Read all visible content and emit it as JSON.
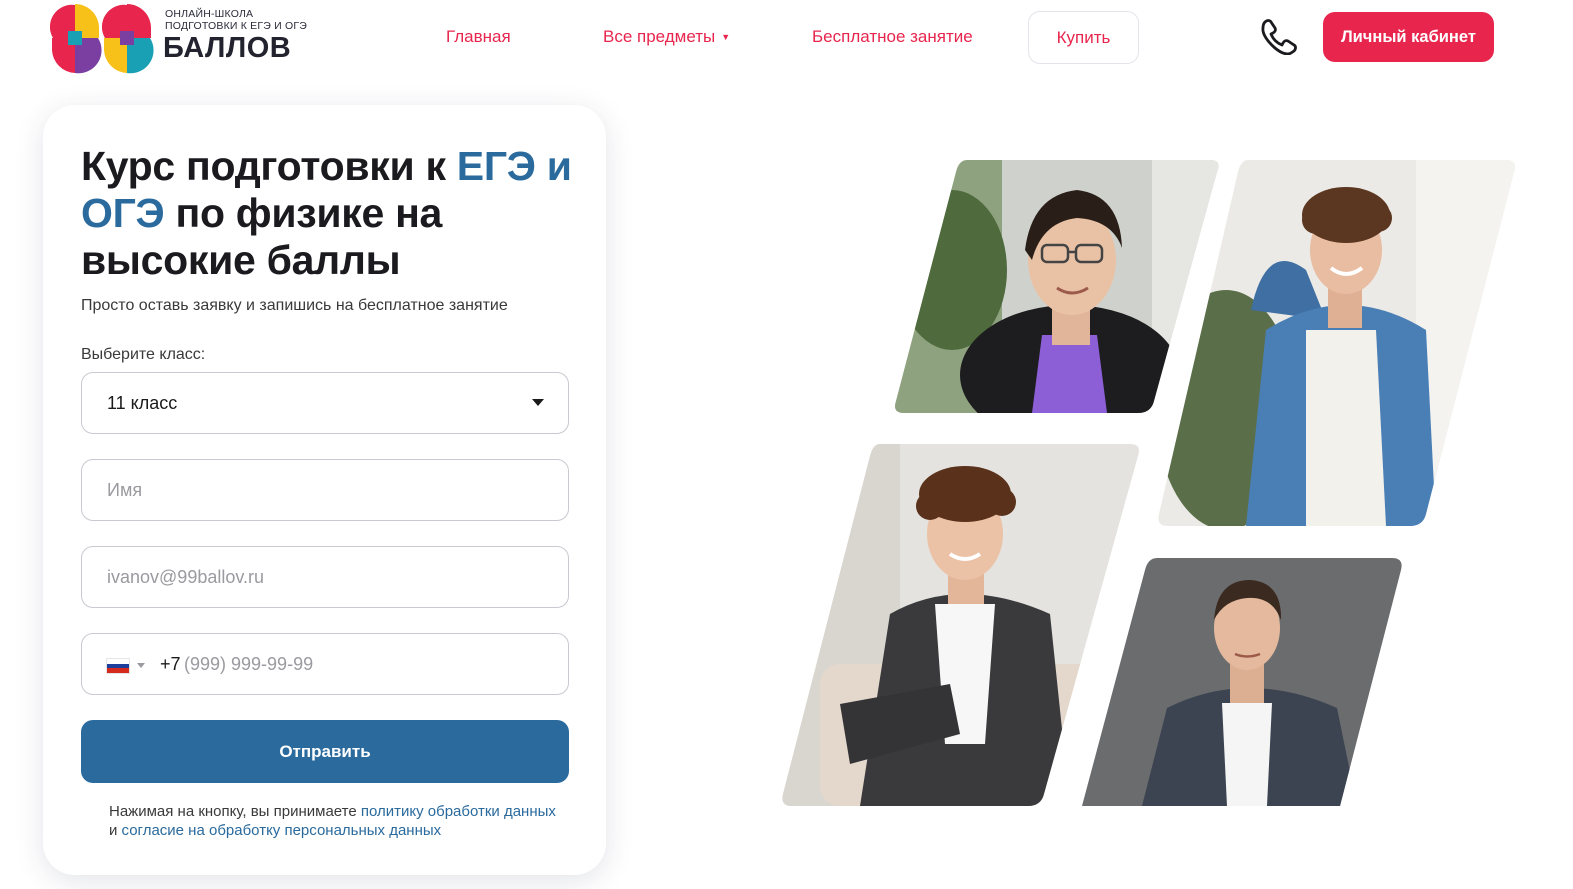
{
  "header": {
    "logo_subtitle_line1": "Онлайн-школа",
    "logo_subtitle_line2": "подготовки к ЕГЭ и ОГЭ",
    "logo_word": "БАЛЛОВ",
    "nav": {
      "home": "Главная",
      "subjects": "Все предметы",
      "free_lesson": "Бесплатное занятие"
    },
    "buy_label": "Купить",
    "cabinet_label": "Личный кабинет"
  },
  "form": {
    "title_part1": "Курс подготовки к ",
    "title_accent1": "ЕГЭ",
    "title_part2": " и ",
    "title_accent2": "ОГЭ",
    "title_part3": " по физике на высокие баллы",
    "subtitle": "Просто оставь заявку и запишись на бесплатное занятие",
    "class_label": "Выберите класс:",
    "class_value": "11 класс",
    "name_placeholder": "Имя",
    "email_placeholder": "ivanov@99ballov.ru",
    "phone_prefix": "+7",
    "phone_placeholder": "(999) 999-99-99",
    "submit_label": "Отправить",
    "consent_text1": "Нажимая на кнопку, вы принимаете ",
    "consent_link1": "политику обработки данных",
    "consent_text2": " и ",
    "consent_link2": "согласие на обработку персональных данных"
  },
  "colors": {
    "brand_red": "#e8254d",
    "brand_blue": "#2a6a9d"
  },
  "icons": {
    "phone": "phone-icon",
    "dropdown": "chevron-down-icon",
    "flag": "russia-flag-icon"
  }
}
